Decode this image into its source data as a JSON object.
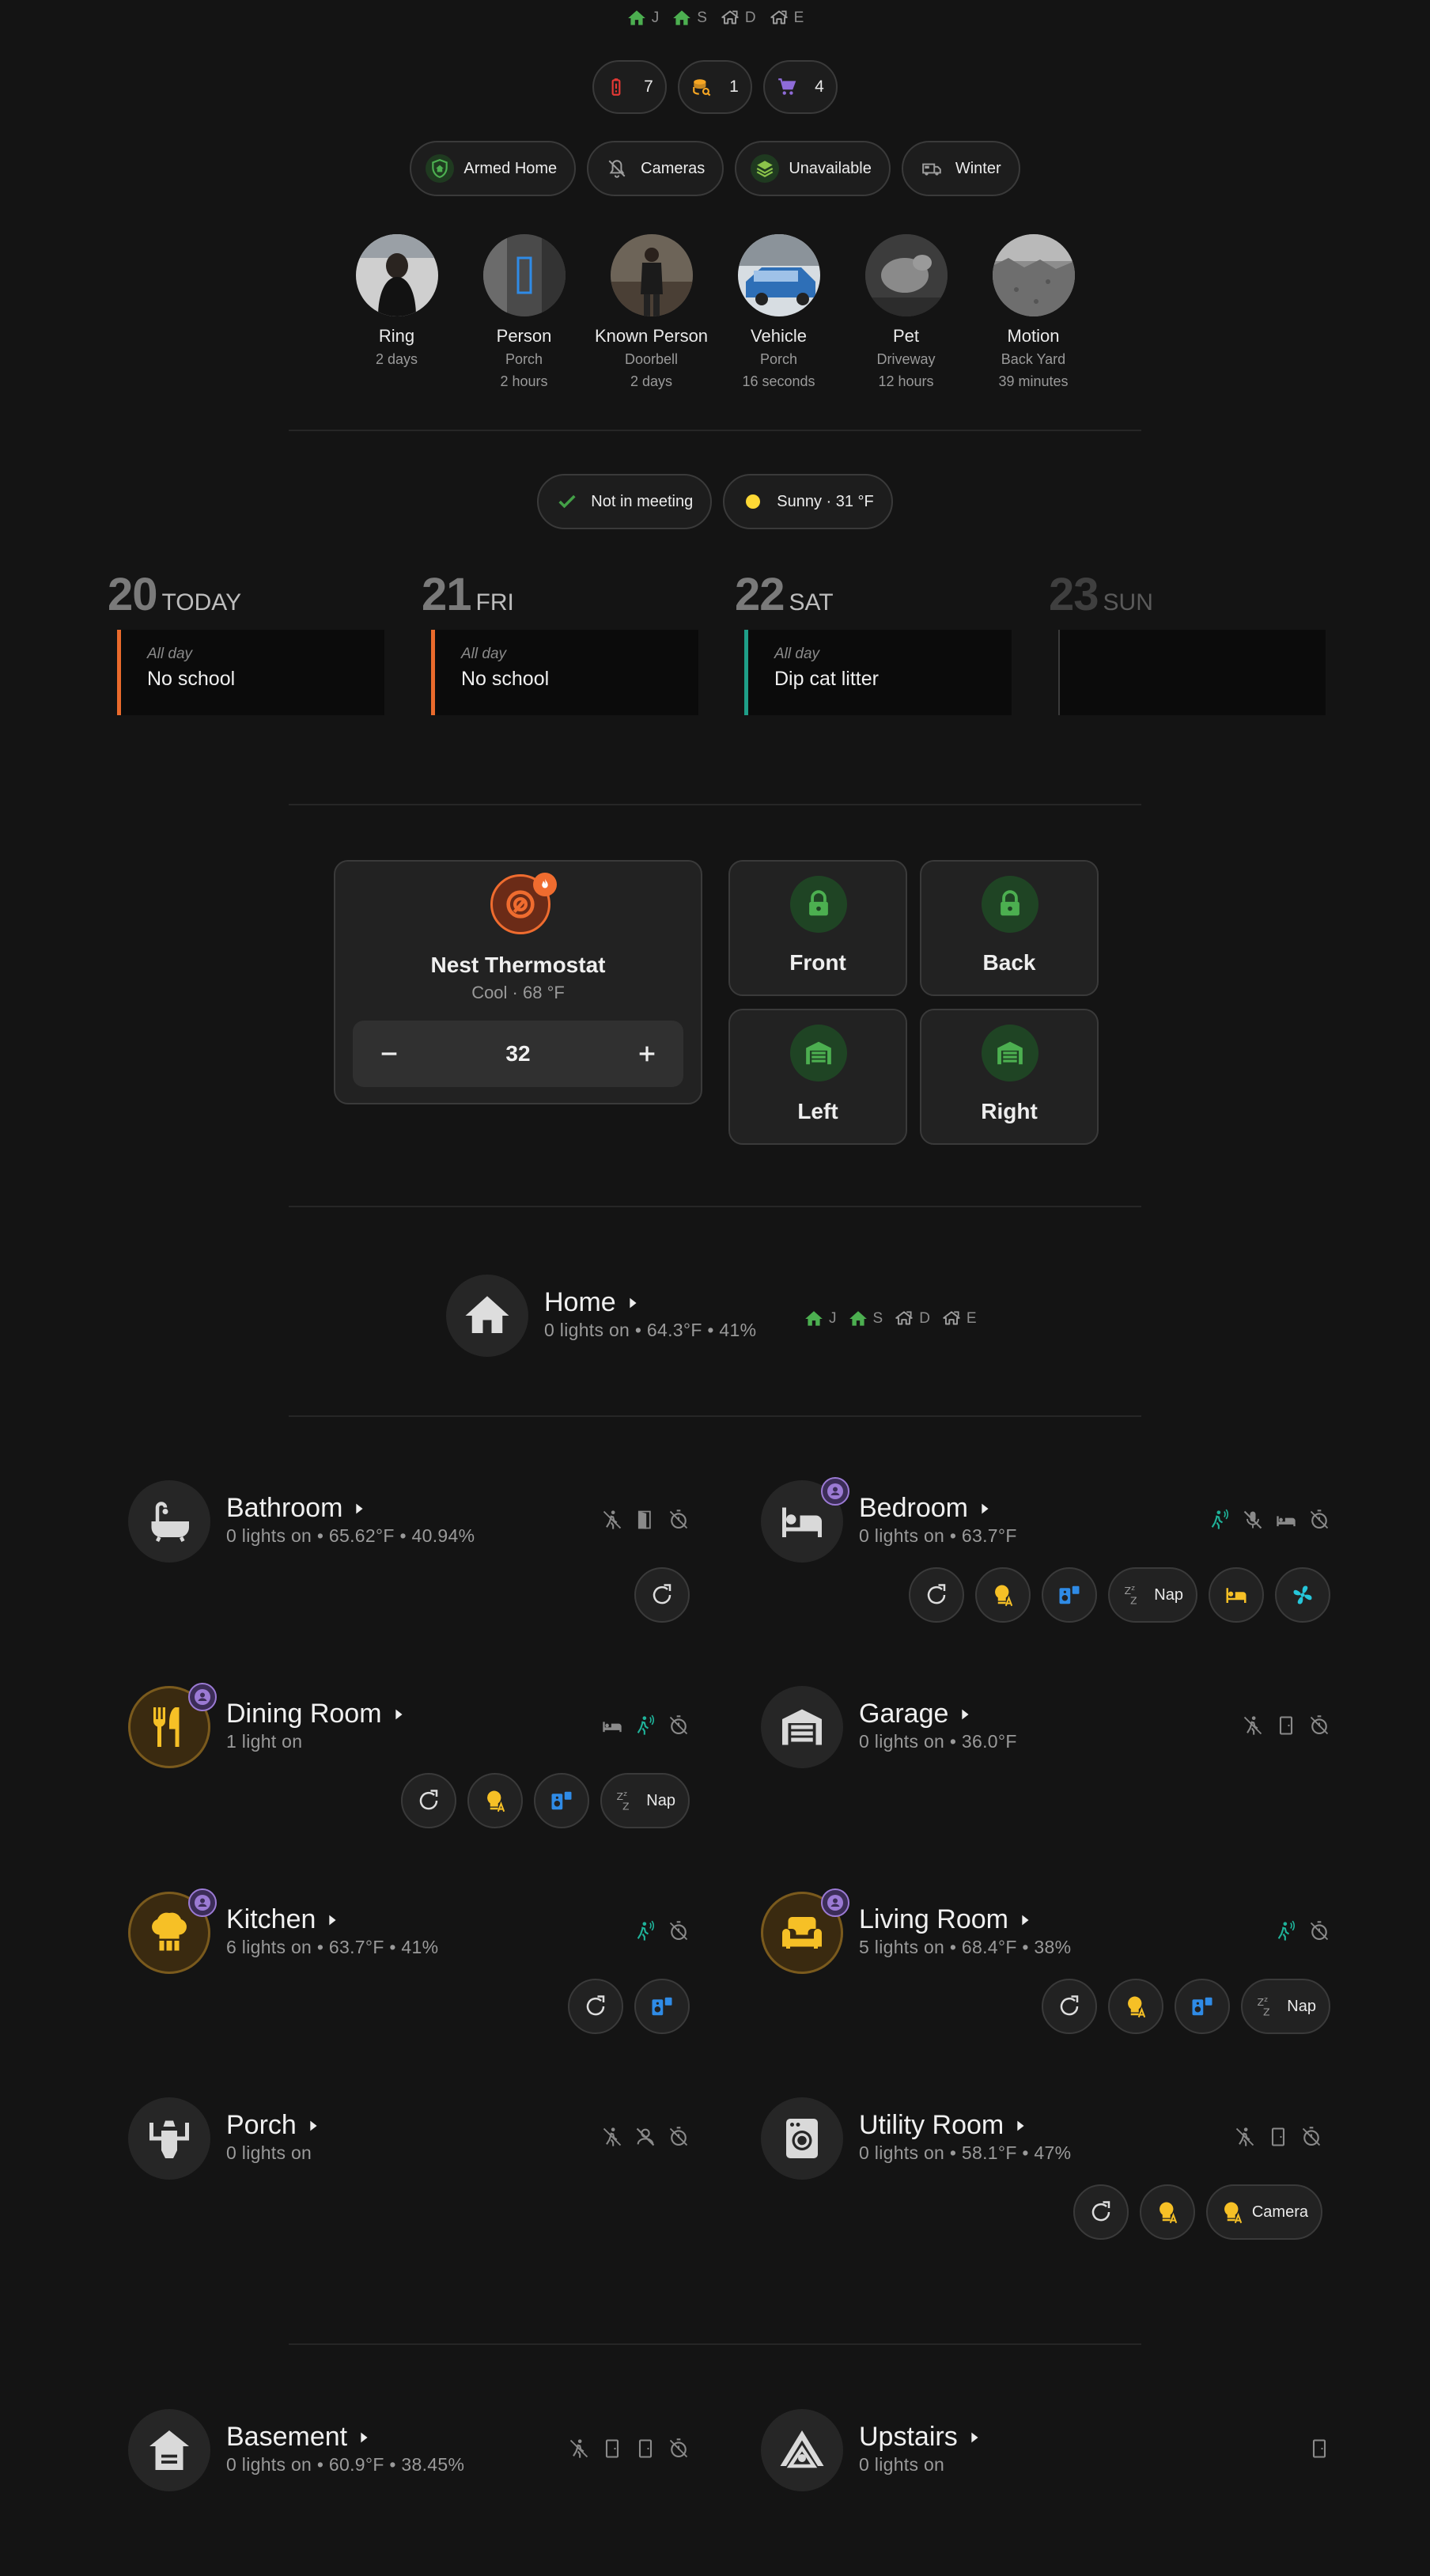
{
  "presence": [
    {
      "initial": "J",
      "state": "home"
    },
    {
      "initial": "S",
      "state": "home"
    },
    {
      "initial": "D",
      "state": "away"
    },
    {
      "initial": "E",
      "state": "away"
    }
  ],
  "counts": [
    {
      "icon": "battery-alert-icon",
      "value": "7"
    },
    {
      "icon": "database-search-icon",
      "value": "1"
    },
    {
      "icon": "cart-icon",
      "value": "4"
    }
  ],
  "status_pills": [
    {
      "icon": "shield-home-icon",
      "label": "Armed Home"
    },
    {
      "icon": "bell-off-icon",
      "label": "Cameras"
    },
    {
      "icon": "layers-icon",
      "label": "Unavailable"
    },
    {
      "icon": "rv-truck-icon",
      "label": "Winter"
    }
  ],
  "cameras": [
    {
      "name": "Ring",
      "line1": "2 days",
      "line2": ""
    },
    {
      "name": "Person",
      "line1": "Porch",
      "line2": "2 hours"
    },
    {
      "name": "Known Person",
      "line1": "Doorbell",
      "line2": "2 days"
    },
    {
      "name": "Vehicle",
      "line1": "Porch",
      "line2": "16 seconds"
    },
    {
      "name": "Pet",
      "line1": "Driveway",
      "line2": "12 hours"
    },
    {
      "name": "Motion",
      "line1": "Back Yard",
      "line2": "39 minutes"
    }
  ],
  "info_pills": [
    {
      "icon": "check-icon",
      "label": "Not in meeting"
    },
    {
      "icon": "sun-icon",
      "label": "Sunny · 31 °F"
    }
  ],
  "calendar": [
    {
      "day": "20",
      "weekday": "TODAY",
      "allday": "All day",
      "event": "No school",
      "color": "#e96a2c"
    },
    {
      "day": "21",
      "weekday": "FRI",
      "allday": "All day",
      "event": "No school",
      "color": "#e96a2c"
    },
    {
      "day": "22",
      "weekday": "SAT",
      "allday": "All day",
      "event": "Dip cat litter",
      "color": "#1f9e88"
    },
    {
      "day": "23",
      "weekday": "SUN",
      "allday": "",
      "event": "",
      "color": "#3a3a3a"
    }
  ],
  "thermostat": {
    "name": "Nest Thermostat",
    "state": "Cool · 68 °F",
    "setpoint": "32"
  },
  "locks": [
    {
      "label": "Front",
      "icon": "lock-icon"
    },
    {
      "label": "Back",
      "icon": "lock-icon"
    },
    {
      "label": "Left",
      "icon": "garage-icon"
    },
    {
      "label": "Right",
      "icon": "garage-icon"
    }
  ],
  "home": {
    "name": "Home",
    "summary": "0 lights on • 64.3°F • 41%"
  },
  "rooms": [
    {
      "name": "Bathroom",
      "summary": "0 lights on • 65.62°F • 40.94%",
      "icon": "bathtub-icon",
      "on": false,
      "occupied": false,
      "sensors": [
        "motion-off-icon",
        "door-open-icon",
        "timer-off-icon"
      ],
      "actions": [
        {
          "icon": "refresh-icon",
          "label": ""
        }
      ]
    },
    {
      "name": "Bedroom",
      "summary": "0 lights on • 63.7°F",
      "icon": "bed-icon",
      "on": false,
      "occupied": true,
      "sensors": [
        "motion-icon",
        "mic-off-icon",
        "bed-sensor-icon",
        "timer-off-icon"
      ],
      "actions": [
        {
          "icon": "refresh-icon",
          "label": ""
        },
        {
          "icon": "bulb-auto-icon",
          "label": ""
        },
        {
          "icon": "speaker-icon",
          "label": ""
        },
        {
          "icon": "sleep-icon",
          "label": "Nap"
        },
        {
          "icon": "bed-icon",
          "label": ""
        },
        {
          "icon": "fan-icon",
          "label": ""
        }
      ]
    },
    {
      "name": "Dining Room",
      "summary": "1 light on",
      "icon": "utensils-icon",
      "on": true,
      "occupied": true,
      "sensors": [
        "bed-sensor-icon",
        "motion-icon",
        "timer-off-icon"
      ],
      "actions": [
        {
          "icon": "refresh-icon",
          "label": ""
        },
        {
          "icon": "bulb-auto-icon",
          "label": ""
        },
        {
          "icon": "speaker-icon",
          "label": ""
        },
        {
          "icon": "sleep-icon",
          "label": "Nap"
        }
      ]
    },
    {
      "name": "Garage",
      "summary": "0 lights on • 36.0°F",
      "icon": "garage-icon",
      "on": false,
      "occupied": false,
      "sensors": [
        "motion-off-icon",
        "door-closed-icon",
        "timer-off-icon"
      ],
      "actions": []
    },
    {
      "name": "Kitchen",
      "summary": "6 lights on • 63.7°F • 41%",
      "icon": "chef-hat-icon",
      "on": true,
      "occupied": true,
      "sensors": [
        "motion-icon",
        "timer-off-icon"
      ],
      "actions": [
        {
          "icon": "refresh-icon",
          "label": ""
        },
        {
          "icon": "speaker-icon",
          "label": ""
        }
      ]
    },
    {
      "name": "Living Room",
      "summary": "5 lights on • 68.4°F • 38%",
      "icon": "sofa-icon",
      "on": true,
      "occupied": true,
      "sensors": [
        "motion-icon",
        "timer-off-icon"
      ],
      "actions": [
        {
          "icon": "refresh-icon",
          "label": ""
        },
        {
          "icon": "bulb-auto-icon",
          "label": ""
        },
        {
          "icon": "speaker-icon",
          "label": ""
        },
        {
          "icon": "sleep-icon",
          "label": "Nap"
        }
      ]
    },
    {
      "name": "Porch",
      "summary": "0 lights on",
      "icon": "lantern-icon",
      "on": false,
      "occupied": false,
      "sensors": [
        "motion-off-icon",
        "person-off-icon",
        "timer-off-icon"
      ],
      "actions": []
    },
    {
      "name": "Utility Room",
      "summary": "0 lights on • 58.1°F • 47%",
      "icon": "washer-icon",
      "on": false,
      "occupied": false,
      "sensors": [
        "motion-off-icon",
        "door-closed-icon",
        "timer-off-icon"
      ],
      "actions": [
        {
          "icon": "refresh-icon",
          "label": ""
        },
        {
          "icon": "bulb-auto-icon",
          "label": ""
        },
        {
          "icon": "bulb-auto-icon",
          "label": "Camera"
        }
      ]
    },
    {
      "name": "Basement",
      "summary": "0 lights on • 60.9°F • 38.45%",
      "icon": "basement-icon",
      "on": false,
      "occupied": false,
      "sensors": [
        "motion-off-icon",
        "door-closed-icon",
        "door-closed-icon",
        "timer-off-icon"
      ],
      "actions": []
    },
    {
      "name": "Upstairs",
      "summary": "0 lights on",
      "icon": "attic-icon",
      "on": false,
      "occupied": false,
      "sensors": [
        "door-closed-icon"
      ],
      "actions": []
    }
  ],
  "colors": {
    "home": "#4caf50",
    "away": "#9e9e9e",
    "accent_orange": "#ef6c2f",
    "light_on": "#f6c026",
    "occupancy": "#9b7ad4",
    "speaker": "#2f8be6",
    "motion": "#1fb39a",
    "fan": "#26c6da"
  }
}
